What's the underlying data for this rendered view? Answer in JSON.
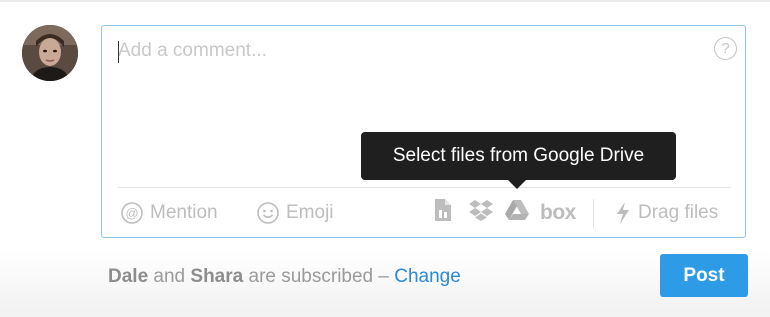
{
  "comment": {
    "placeholder": "Add a comment...",
    "value": ""
  },
  "toolbar": {
    "mention_label": "Mention",
    "emoji_label": "Emoji",
    "box_label": "box",
    "drag_label": "Drag files",
    "icons": [
      "at-icon",
      "smile-icon",
      "file-icon",
      "dropbox-icon",
      "google-drive-icon",
      "box-icon",
      "drag-arrow-icon",
      "help-icon"
    ]
  },
  "tooltip": {
    "text": "Select files from Google Drive"
  },
  "help": {
    "glyph": "?"
  },
  "subscription": {
    "name1": "Dale",
    "and_text": "and",
    "name2": "Shara",
    "suffix": "are subscribed –",
    "change_label": "Change"
  },
  "post": {
    "label": "Post"
  },
  "colors": {
    "accent": "#2d9be6",
    "link": "#2b8ad6",
    "focus_border": "#8ec8ec",
    "tooltip_bg": "#1f1f1f",
    "muted": "#bdbdbd"
  }
}
